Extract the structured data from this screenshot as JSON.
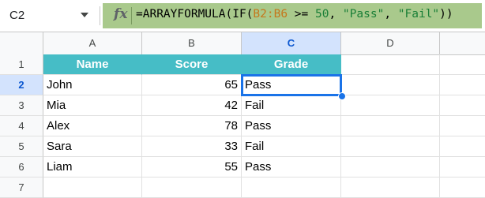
{
  "formula_bar": {
    "name_box": "C2",
    "fx_label": "fx",
    "formula_parts": {
      "p1": "=ARRAYFORMULA(IF(",
      "range": "B2:B6",
      "p2": " >= ",
      "number": "50",
      "p3": ", ",
      "str1": "\"Pass\"",
      "p4": ", ",
      "str2": "\"Fail\"",
      "p5": "))"
    }
  },
  "columns": [
    "A",
    "B",
    "C",
    "D"
  ],
  "selected_cell": "C2",
  "rows": [
    {
      "num": "1",
      "a": "Name",
      "b": "Score",
      "c": "Grade"
    },
    {
      "num": "2",
      "a": "John",
      "b": "65",
      "c": "Pass"
    },
    {
      "num": "3",
      "a": "Mia",
      "b": "42",
      "c": "Fail"
    },
    {
      "num": "4",
      "a": "Alex",
      "b": "78",
      "c": "Pass"
    },
    {
      "num": "5",
      "a": "Sara",
      "b": "33",
      "c": "Fail"
    },
    {
      "num": "6",
      "a": "Liam",
      "b": "55",
      "c": "Pass"
    },
    {
      "num": "7",
      "a": "",
      "b": "",
      "c": ""
    }
  ],
  "colors": {
    "header_fill": "#46bdc6",
    "formula_bar_highlight": "#a9c98c",
    "selection": "#1a73e8"
  }
}
